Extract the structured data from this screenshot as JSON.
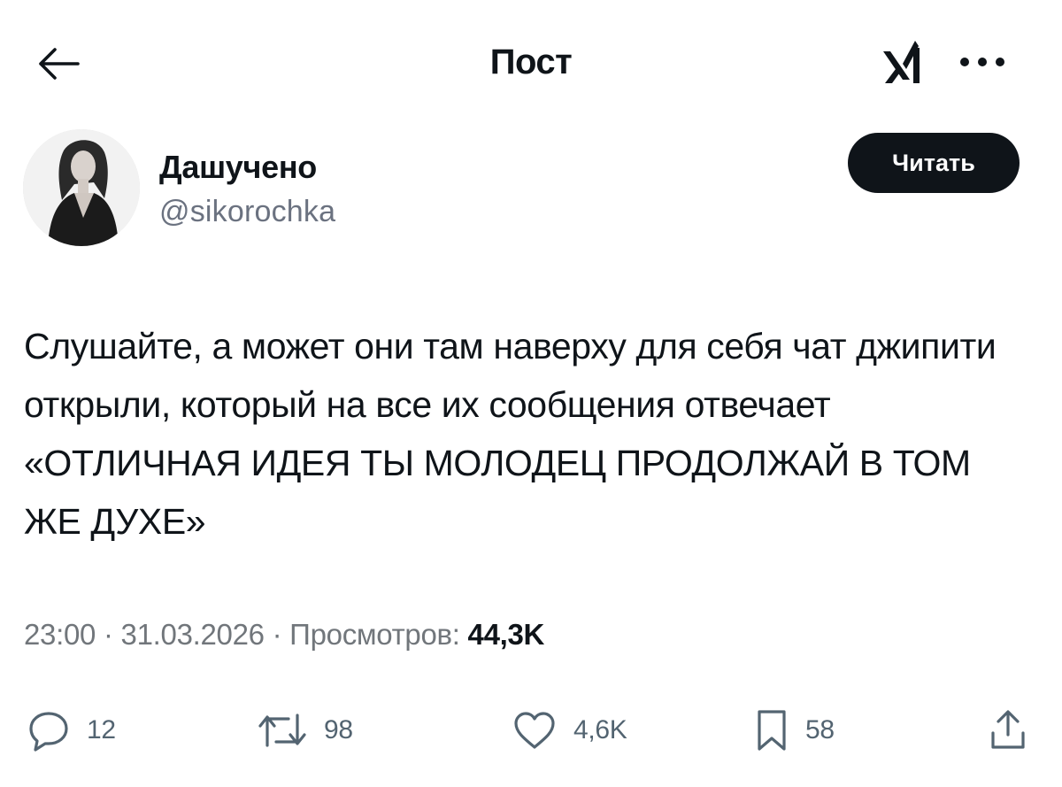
{
  "header": {
    "title": "Пост",
    "back_icon": "arrow-left-icon",
    "grok_icon": "grok-logo-icon",
    "more_icon": "more-horizontal-icon"
  },
  "author": {
    "display_name": "Дашучено",
    "handle": "@sikorochka",
    "follow_label": "Читать",
    "avatar_icon": "user-avatar"
  },
  "post": {
    "text": "Слушайте, а может они там наверху для себя чат джипити открыли, который на все их сообщения отвечает «ОТЛИЧНАЯ ИДЕЯ ТЫ МОЛОДЕЦ ПРОДОЛЖАЙ В ТОМ ЖЕ ДУХЕ»"
  },
  "meta": {
    "time": "23:00",
    "separator": "·",
    "date": "31.03.2026",
    "views_label": "Просмотров:",
    "views_count": "44,3K"
  },
  "actions": {
    "reply_count": "12",
    "retweet_count": "98",
    "like_count": "4,6K",
    "bookmark_count": "58"
  },
  "colors": {
    "text_primary": "#0f1419",
    "text_secondary": "#71767b",
    "icon_gray": "#536471",
    "button_bg": "#0f1419",
    "button_text": "#ffffff"
  }
}
